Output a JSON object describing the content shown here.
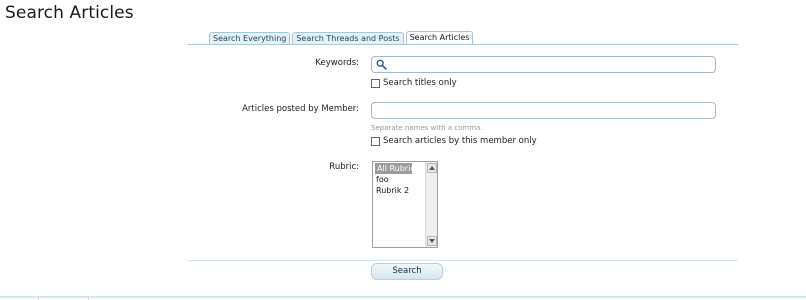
{
  "page": {
    "title": "Search Articles"
  },
  "tabs": [
    {
      "label": "Search Everything",
      "active": false
    },
    {
      "label": "Search Threads and Posts",
      "active": false
    },
    {
      "label": "Search Articles",
      "active": true
    }
  ],
  "form": {
    "keywords": {
      "label": "Keywords:",
      "value": "",
      "placeholder": "",
      "icon": "search-icon"
    },
    "titles_only": {
      "label": "Search titles only",
      "checked": false
    },
    "member": {
      "label": "Articles posted by Member:",
      "value": "",
      "placeholder": "",
      "hint": "Separate names with a comma."
    },
    "member_only": {
      "label": "Search articles by this member only",
      "checked": false
    },
    "rubric": {
      "label": "Rubric:",
      "options": [
        "All Rubrics",
        "foo",
        "Rubrik 2"
      ],
      "selected": "All Rubrics"
    },
    "submit_label": "Search"
  },
  "colors": {
    "tab_border": "#a7c6d6",
    "tab_bg": "#e6f1f6",
    "button_top": "#f2f8fb",
    "button_bottom": "#d5e6f0"
  }
}
